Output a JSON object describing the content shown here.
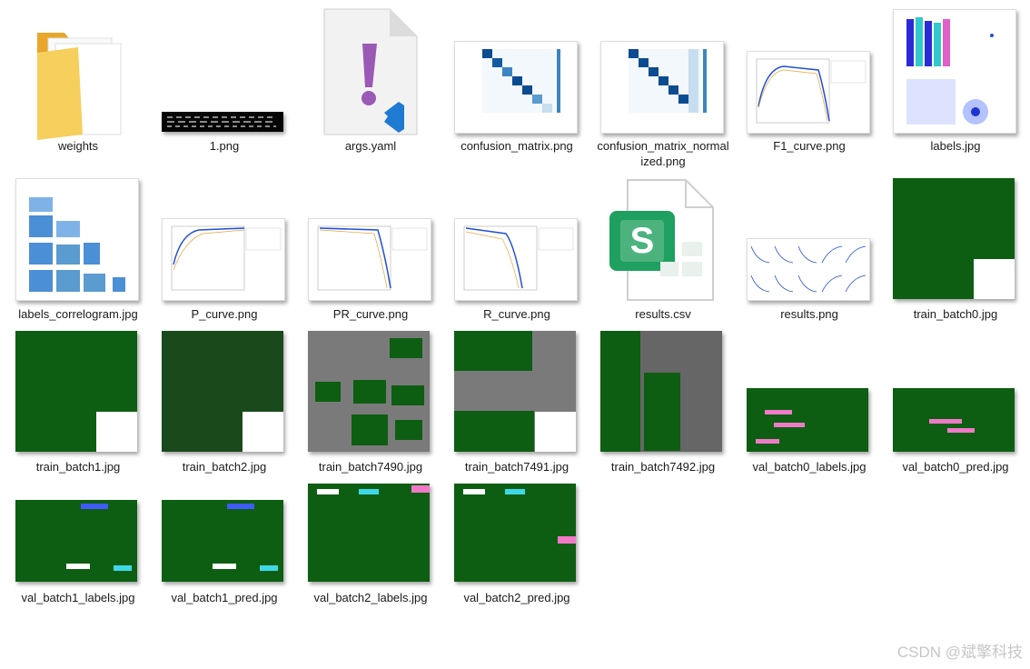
{
  "files": [
    {
      "name": "weights",
      "type": "folder"
    },
    {
      "name": "1.png",
      "type": "image"
    },
    {
      "name": "args.yaml",
      "type": "yaml"
    },
    {
      "name": "confusion_matrix.png",
      "type": "image"
    },
    {
      "name": "confusion_matrix_normalized.png",
      "type": "image"
    },
    {
      "name": "F1_curve.png",
      "type": "image"
    },
    {
      "name": "labels.jpg",
      "type": "image"
    },
    {
      "name": "labels_correlogram.jpg",
      "type": "image"
    },
    {
      "name": "P_curve.png",
      "type": "image"
    },
    {
      "name": "PR_curve.png",
      "type": "image"
    },
    {
      "name": "R_curve.png",
      "type": "image"
    },
    {
      "name": "results.csv",
      "type": "csv"
    },
    {
      "name": "results.png",
      "type": "image"
    },
    {
      "name": "train_batch0.jpg",
      "type": "image"
    },
    {
      "name": "train_batch1.jpg",
      "type": "image"
    },
    {
      "name": "train_batch2.jpg",
      "type": "image"
    },
    {
      "name": "train_batch7490.jpg",
      "type": "image"
    },
    {
      "name": "train_batch7491.jpg",
      "type": "image"
    },
    {
      "name": "train_batch7492.jpg",
      "type": "image"
    },
    {
      "name": "val_batch0_labels.jpg",
      "type": "image"
    },
    {
      "name": "val_batch0_pred.jpg",
      "type": "image"
    },
    {
      "name": "val_batch1_labels.jpg",
      "type": "image"
    },
    {
      "name": "val_batch1_pred.jpg",
      "type": "image"
    },
    {
      "name": "val_batch2_labels.jpg",
      "type": "image"
    },
    {
      "name": "val_batch2_pred.jpg",
      "type": "image"
    }
  ],
  "label_lines": {
    "confusion_matrix_normalized": [
      "confusion_matrix_normal",
      "ized.png"
    ]
  },
  "watermark": "CSDN @斌擎科技",
  "colors": {
    "folder": "#f4c74f",
    "yaml_icon": "#9b59b6",
    "vscode": "#1f7ad2",
    "csv_green": "#20a060",
    "pcb_green": "#0d5e12",
    "chart_blue": "#1f4fd6"
  }
}
